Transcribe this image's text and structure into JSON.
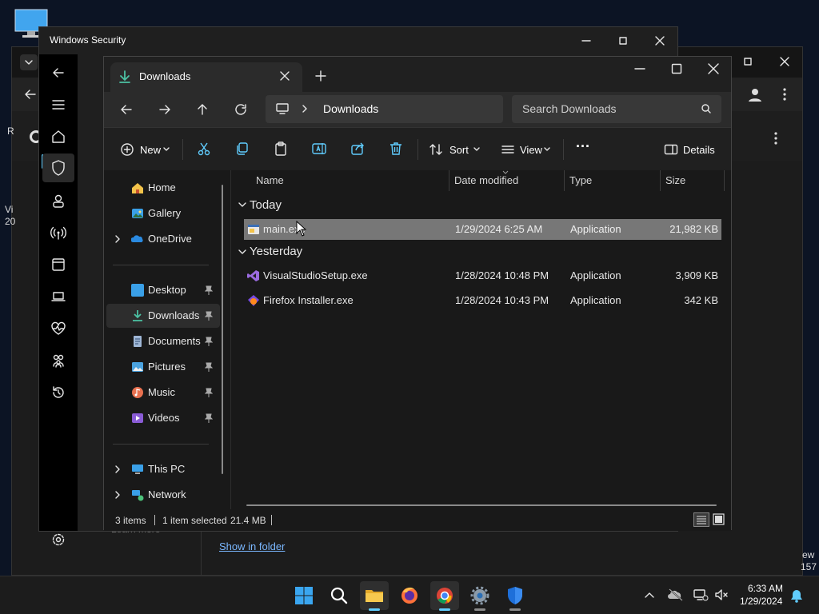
{
  "desktop": {
    "icon": "monitor-icon"
  },
  "background_window": {
    "side_text_left_1": "R",
    "side_text_left_2": "Vi",
    "side_text_left_3": "20",
    "side_text_right_1": "ew",
    "side_text_right_2": "157",
    "partial_text": "Learn more",
    "link_show_in_folder": "Show in folder"
  },
  "windows_security": {
    "title": "Windows Security",
    "nav_icons": [
      "back-icon",
      "menu-icon",
      "home-icon",
      "shield-icon",
      "account-icon",
      "network-icon",
      "app-browser-icon",
      "device-icon",
      "health-icon",
      "family-icon",
      "history-icon",
      "settings-icon"
    ]
  },
  "explorer": {
    "tab_title": "Downloads",
    "breadcrumb": "Downloads",
    "search_placeholder": "Search Downloads",
    "toolbar": {
      "new": "New",
      "sort": "Sort",
      "view": "View",
      "more": "...",
      "details": "Details"
    },
    "nav": {
      "home": "Home",
      "gallery": "Gallery",
      "onedrive": "OneDrive",
      "desktop": "Desktop",
      "downloads": "Downloads",
      "documents": "Documents",
      "pictures": "Pictures",
      "music": "Music",
      "videos": "Videos",
      "thispc": "This PC",
      "network": "Network"
    },
    "columns": {
      "name": "Name",
      "date": "Date modified",
      "type": "Type",
      "size": "Size"
    },
    "groups": {
      "today": "Today",
      "yesterday": "Yesterday"
    },
    "files": [
      {
        "name": "main.exe",
        "date": "1/29/2024 6:25 AM",
        "type": "Application",
        "size": "21,982 KB"
      },
      {
        "name": "VisualStudioSetup.exe",
        "date": "1/28/2024 10:48 PM",
        "type": "Application",
        "size": "3,909 KB"
      },
      {
        "name": "Firefox Installer.exe",
        "date": "1/28/2024 10:43 PM",
        "type": "Application",
        "size": "342 KB"
      }
    ],
    "status": {
      "items": "3 items",
      "selected": "1 item selected",
      "size": "21.4 MB"
    }
  },
  "taskbar": {
    "apps": [
      "windows-start-icon",
      "search-icon",
      "file-explorer-icon",
      "firefox-icon",
      "chrome-icon",
      "settings-icon",
      "windows-security-icon"
    ],
    "clock_time": "6:33 AM",
    "clock_date": "1/29/2024"
  },
  "colors": {
    "accent": "#60cdff",
    "selection": "#777777",
    "folder": "#f3c34a"
  }
}
